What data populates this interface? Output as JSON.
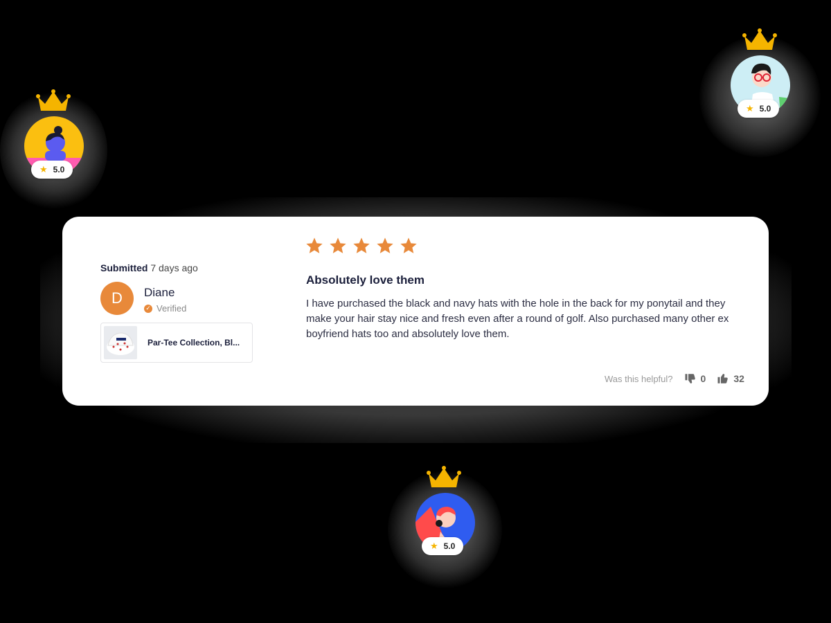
{
  "avatars": [
    {
      "id": "left",
      "rating": "5.0",
      "star_icon": "star-icon",
      "colors": {
        "bg": "#fbbf10",
        "accent": "#ff5cb0"
      }
    },
    {
      "id": "right",
      "rating": "5.0",
      "star_icon": "star-icon",
      "colors": {
        "bg": "#cdeef5",
        "accent": "#222"
      }
    },
    {
      "id": "bottom",
      "rating": "5.0",
      "star_icon": "star-icon",
      "colors": {
        "bg": "#2f5cf0",
        "accent": "#ff4b4b"
      }
    }
  ],
  "review": {
    "submitted_label": "Submitted",
    "submitted_when": "7 days ago",
    "user_initial": "D",
    "user_name": "Diane",
    "verified_label": "Verified",
    "product_name": "Par-Tee Collection, Bl...",
    "rating": 5,
    "title": "Absolutely love them",
    "body": "I have purchased the black and navy hats with the hole in the back for my ponytail and they make your hair stay nice and fresh even after a round of golf. Also purchased many other ex boyfriend hats too and absolutely love them.",
    "helpful_label": "Was this helpful?",
    "thumbs_down_count": "0",
    "thumbs_up_count": "32"
  },
  "colors": {
    "accent": "#e8893a",
    "star": "#e8893a",
    "crown": "#f5b400",
    "text_dark": "#1b1f3b"
  }
}
